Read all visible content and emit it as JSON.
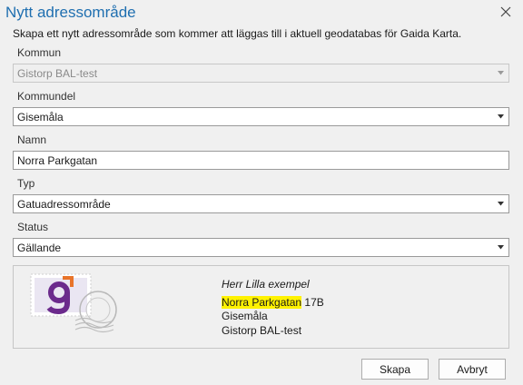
{
  "dialog": {
    "title": "Nytt adressområde",
    "subtitle": "Skapa ett nytt adressområde som kommer att läggas till i aktuell geodatabas för Gaida Karta."
  },
  "fields": {
    "kommun": {
      "label": "Kommun",
      "value": "Gistorp BAL-test",
      "disabled": true
    },
    "kommundel": {
      "label": "Kommundel",
      "value": "Gisemåla"
    },
    "namn": {
      "label": "Namn",
      "value": "Norra Parkgatan"
    },
    "typ": {
      "label": "Typ",
      "value": "Gatuadressområde"
    },
    "status": {
      "label": "Status",
      "value": "Gällande"
    }
  },
  "preview": {
    "recipient": "Herr Lilla exempel",
    "street": "Norra Parkgatan",
    "number": "17B",
    "locality": "Gisemåla",
    "municipality": "Gistorp BAL-test",
    "highlight_color": "#fff200"
  },
  "buttons": {
    "create": "Skapa",
    "cancel": "Avbryt"
  },
  "colors": {
    "title": "#1f6fb0",
    "logo_purple": "#6b2a8c",
    "logo_orange": "#e8742a"
  },
  "icons": {
    "close": "close-icon",
    "dropdown": "chevron-down-icon",
    "stamp": "postage-stamp-icon"
  }
}
